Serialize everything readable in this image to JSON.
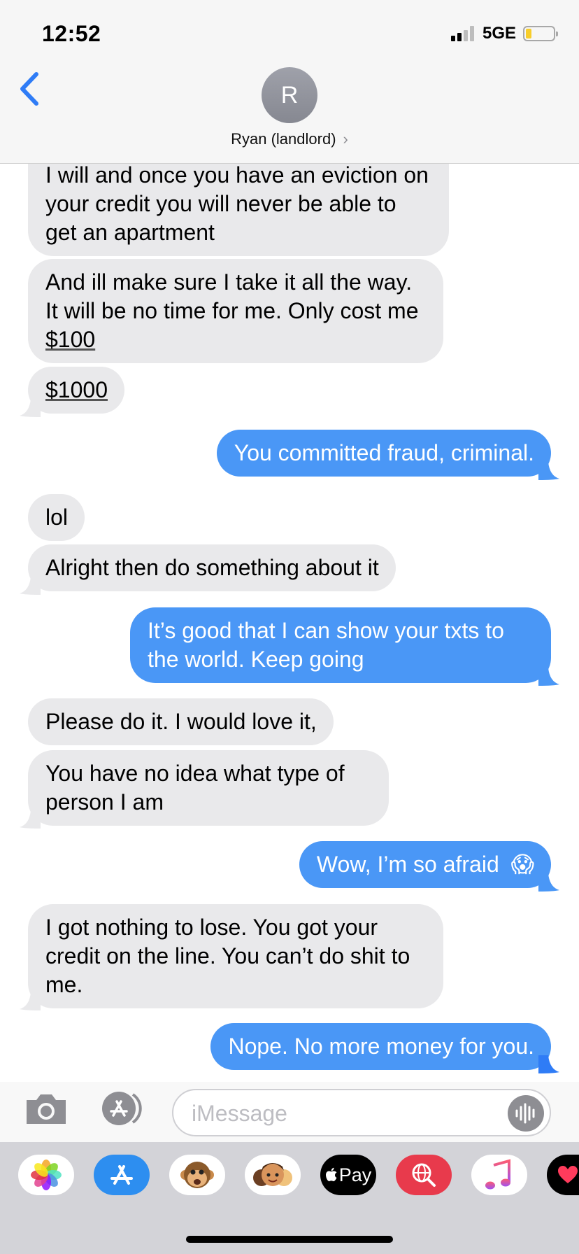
{
  "status_bar": {
    "time": "12:52",
    "network": "5GE"
  },
  "contact": {
    "initial": "R",
    "name": "Ryan (landlord)"
  },
  "messages": [
    {
      "from": "them",
      "text": "I will and once you have an eviction on your credit you will never be able to get an apartment"
    },
    {
      "from": "them",
      "text_before": "And ill make sure I take it all the way.  It will be no time for me.  Only cost me ",
      "text_link": "$100"
    },
    {
      "from": "them",
      "text_link": "$1000"
    },
    {
      "from": "me",
      "text": "You committed fraud, criminal."
    },
    {
      "from": "them",
      "text": "lol"
    },
    {
      "from": "them",
      "text": "Alright then do something about it"
    },
    {
      "from": "me",
      "text": "It’s good that I can show your txts to the world. Keep going"
    },
    {
      "from": "them",
      "text": "Please do it.  I would love it,"
    },
    {
      "from": "them",
      "text": "You have no idea what type of person I am"
    },
    {
      "from": "me",
      "text": "Wow, I’m so afraid",
      "emoji": "😱"
    },
    {
      "from": "them",
      "text": "I got nothing to lose.  You got your credit on the line.  You can’t do shit to me."
    },
    {
      "from": "me",
      "text": "Nope. No more money for you."
    }
  ],
  "input": {
    "placeholder": "iMessage"
  },
  "app_drawer": {
    "apps": [
      {
        "name": "photos-app",
        "icon": "photos-icon"
      },
      {
        "name": "app-store-app",
        "icon": "app-store-icon"
      },
      {
        "name": "animoji-app",
        "icon": "monkey-icon"
      },
      {
        "name": "memoji-app",
        "icon": "memoji-icon"
      },
      {
        "name": "apple-pay-app",
        "icon": "apple-pay-icon",
        "label": "Pay"
      },
      {
        "name": "images-search-app",
        "icon": "globe-search-icon"
      },
      {
        "name": "music-app",
        "icon": "music-note-icon"
      },
      {
        "name": "digital-touch-app",
        "icon": "heart-icon"
      }
    ]
  },
  "colors": {
    "sent_bubble": "#4a97f6",
    "received_bubble": "#e9e9eb",
    "accent": "#2f7cf6"
  }
}
